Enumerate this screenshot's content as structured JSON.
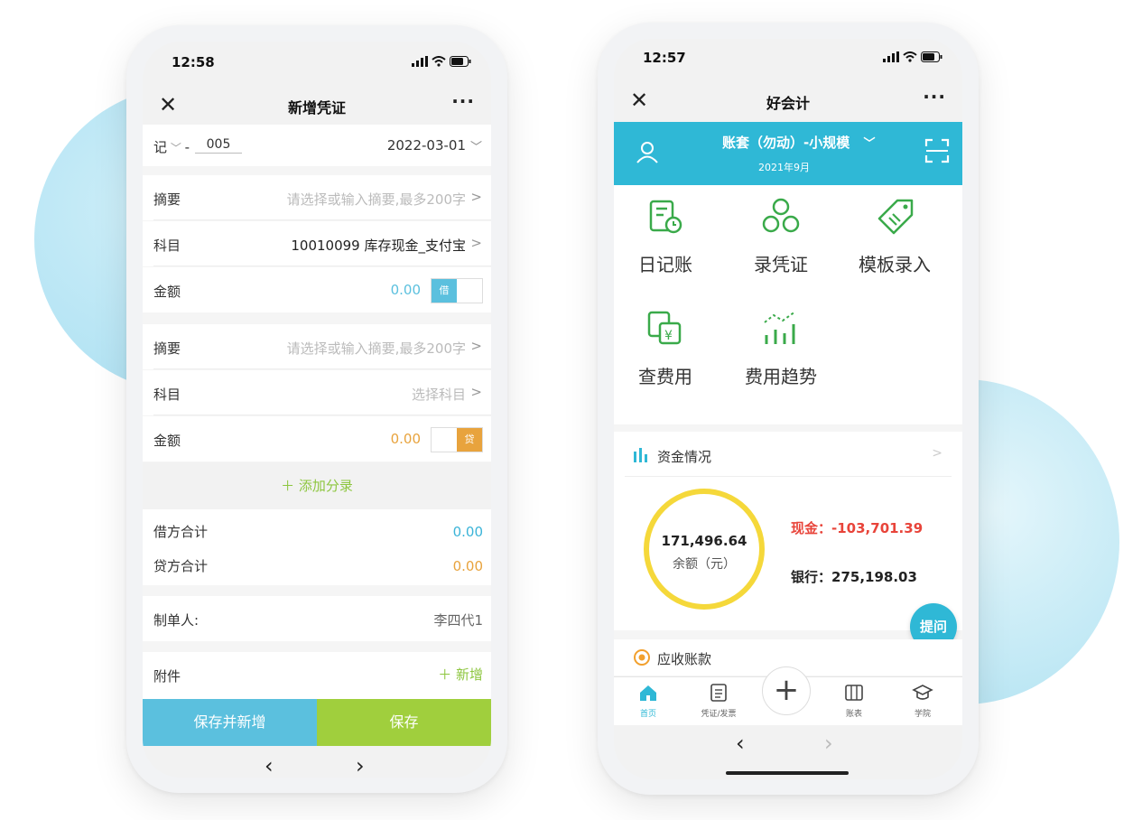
{
  "left": {
    "status_time": "12:58",
    "nav": {
      "close": "✕",
      "title": "新增凭证",
      "more": "···"
    },
    "voucher": {
      "word": "记",
      "separator": "-",
      "number": "005",
      "date": "2022-03-01"
    },
    "entries": [
      {
        "summary_label": "摘要",
        "summary_placeholder": "请选择或输入摘要,最多200字",
        "subject_label": "科目",
        "subject_value": "10010099 库存现金_支付宝",
        "amount_label": "金额",
        "amount_value": "0.00",
        "direction": "借"
      },
      {
        "summary_label": "摘要",
        "summary_placeholder": "请选择或输入摘要,最多200字",
        "subject_label": "科目",
        "subject_value": "选择科目",
        "amount_label": "金额",
        "amount_value": "0.00",
        "direction": "贷"
      }
    ],
    "add_entry": "添加分录",
    "totals": {
      "debit_label": "借方合计",
      "debit_value": "0.00",
      "credit_label": "贷方合计",
      "credit_value": "0.00"
    },
    "maker": {
      "label": "制单人:",
      "value": "李四代1"
    },
    "attachment": {
      "label": "附件",
      "action": "新增"
    },
    "buttons": {
      "save_new": "保存并新增",
      "save": "保存"
    },
    "colors": {
      "blue": "#5bc0de",
      "green": "#a0cf3d",
      "orange": "#e8a33d",
      "teal": "#3bb4d8"
    }
  },
  "right": {
    "status_time": "12:57",
    "nav": {
      "close": "✕",
      "title": "好会计",
      "more": "···"
    },
    "account": {
      "name": "账套（勿动）-小规模",
      "period": "2021年9月"
    },
    "shortcuts": [
      "日记账",
      "录凭证",
      "模板录入",
      "查费用",
      "费用趋势"
    ],
    "funds": {
      "title": "资金情况",
      "balance": "171,496.64",
      "balance_label": "余额（元）",
      "cash_label": "现金：",
      "cash_value": "-103,701.39",
      "bank_label": "银行：",
      "bank_value": "275,198.03"
    },
    "ask_button": "提问",
    "receivables": {
      "title": "应收账款"
    },
    "tabs": [
      "首页",
      "凭证/发票",
      "",
      "账表",
      "学院"
    ],
    "colors": {
      "header": "#2fb8d6",
      "icon_green": "#3aaa4a",
      "gauge": "#f5d83a",
      "red": "#e8443a"
    }
  }
}
